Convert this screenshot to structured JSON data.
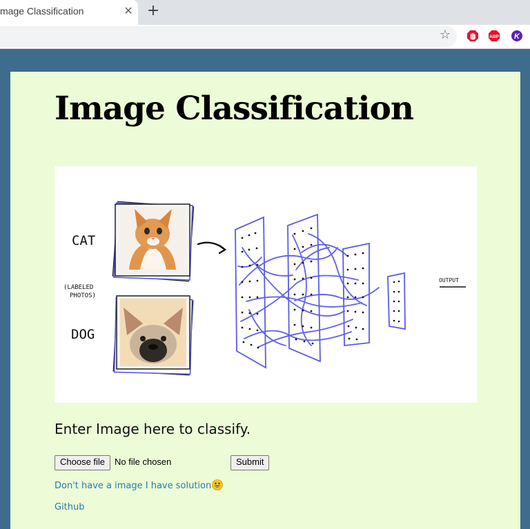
{
  "browser": {
    "tab_title": "mage Classification",
    "tab_close_glyph": "✕",
    "new_tab_glyph": "+",
    "star_glyph": "☆",
    "extensions": [
      {
        "name": "adblock-icon",
        "color": "#e8112d"
      },
      {
        "name": "abp-icon",
        "label": "ABP",
        "color": "#e8112d"
      },
      {
        "name": "k-extension-icon",
        "label": "K",
        "color": "#5b21b6"
      }
    ]
  },
  "page": {
    "title": "Image Classification",
    "hero": {
      "label_cat": "CAT",
      "label_labeled": "(LABELED",
      "label_photos": "PHOTOS)",
      "label_dog": "DOG",
      "label_output": "OUTPUT"
    },
    "prompt": "Enter Image here to classify.",
    "file_input": {
      "button_label": "Choose file",
      "status": "No file chosen"
    },
    "submit_label": "Submit",
    "solution_link": "Don't have a image I have solution",
    "github_link": "Github"
  },
  "colors": {
    "page_bg": "#3f6c8c",
    "card_bg": "#ebfcd6",
    "link": "#2a7ab0",
    "network_stroke": "#5a5ae6"
  }
}
